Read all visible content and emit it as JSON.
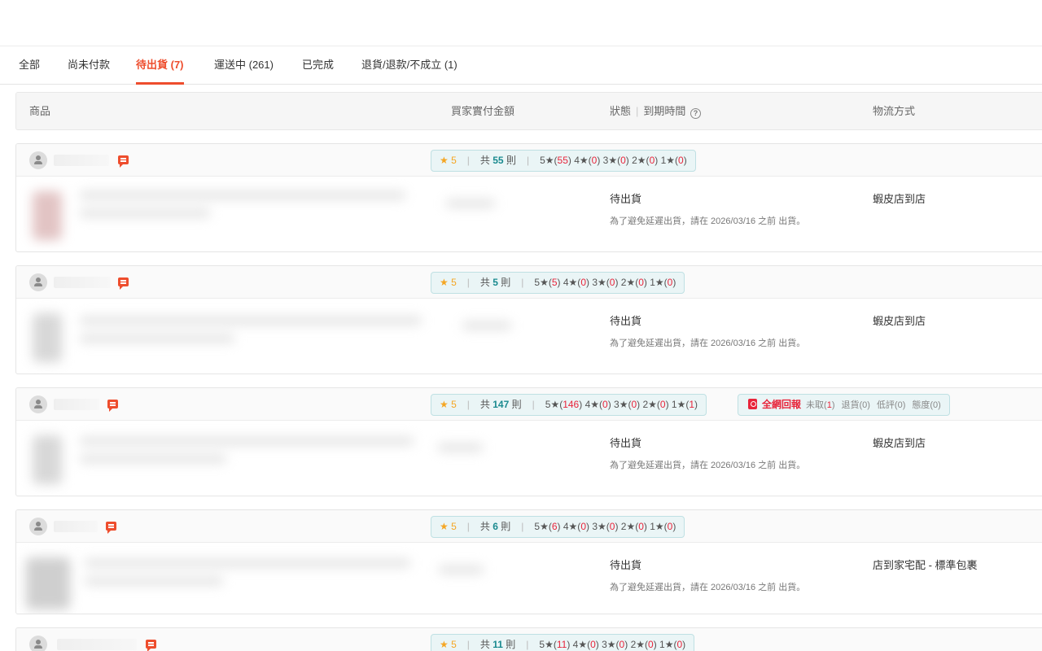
{
  "tabs": [
    {
      "label": "全部"
    },
    {
      "label": "尚未付款"
    },
    {
      "label": "待出貨 (7)"
    },
    {
      "label": "運送中 (261)"
    },
    {
      "label": "已完成"
    },
    {
      "label": "退貨/退款/不成立 (1)"
    }
  ],
  "active_tab": 2,
  "table_header": {
    "product": "商品",
    "amount": "買家實付金額",
    "status": "狀態",
    "separator": "|",
    "deadline": "到期時間",
    "help_glyph": "?",
    "shipping": "物流方式"
  },
  "colors": {
    "accent": "#ee4d2d",
    "teal": "#1a8a8f",
    "alert": "#e8253b"
  },
  "orders": [
    {
      "rating": {
        "star": "★ 5",
        "total_prefix": "共",
        "total": "55",
        "total_suffix": "則",
        "b5": "5★(",
        "c5": "55",
        "b4": ") 4★(",
        "c4": "0",
        "b3": ") 3★(",
        "c3": "0",
        "b2": ") 2★(",
        "c2": "0",
        "b1": ") 1★(",
        "c1": "0",
        "end": ")"
      },
      "status": "待出貨",
      "status_note": "為了避免延遲出貨，請在 2026/03/16 之前 出貨。",
      "shipping": "蝦皮店到店"
    },
    {
      "rating": {
        "star": "★ 5",
        "total_prefix": "共",
        "total": "5",
        "total_suffix": "則",
        "b5": "5★(",
        "c5": "5",
        "b4": ") 4★(",
        "c4": "0",
        "b3": ") 3★(",
        "c3": "0",
        "b2": ") 2★(",
        "c2": "0",
        "b1": ") 1★(",
        "c1": "0",
        "end": ")"
      },
      "status": "待出貨",
      "status_note": "為了避免延遲出貨，請在 2026/03/16 之前 出貨。",
      "shipping": "蝦皮店到店"
    },
    {
      "rating": {
        "star": "★ 5",
        "total_prefix": "共",
        "total": "147",
        "total_suffix": "則",
        "b5": "5★(",
        "c5": "146",
        "b4": ") 4★(",
        "c4": "0",
        "b3": ") 3★(",
        "c3": "0",
        "b2": ") 2★(",
        "c2": "0",
        "b1": ") 1★(",
        "c1": "1",
        "end": ")"
      },
      "net_report": {
        "title": "全網回報",
        "unpicked_label": "未取(",
        "unpicked": "1",
        "unpicked_end": ")",
        "returns": "退貨(0)",
        "low_rating": "低評(0)",
        "attitude": "態度(0)"
      },
      "status": "待出貨",
      "status_note": "為了避免延遲出貨，請在 2026/03/16 之前 出貨。",
      "shipping": "蝦皮店到店"
    },
    {
      "rating": {
        "star": "★ 5",
        "total_prefix": "共",
        "total": "6",
        "total_suffix": "則",
        "b5": "5★(",
        "c5": "6",
        "b4": ") 4★(",
        "c4": "0",
        "b3": ") 3★(",
        "c3": "0",
        "b2": ") 2★(",
        "c2": "0",
        "b1": ") 1★(",
        "c1": "0",
        "end": ")"
      },
      "status": "待出貨",
      "status_note": "為了避免延遲出貨，請在 2026/03/16 之前 出貨。",
      "shipping": "店到家宅配 - 標準包裹"
    },
    {
      "rating": {
        "star": "★ 5",
        "total_prefix": "共",
        "total": "11",
        "total_suffix": "則",
        "b5": "5★(",
        "c5": "11",
        "b4": ") 4★(",
        "c4": "0",
        "b3": ") 3★(",
        "c3": "0",
        "b2": ") 2★(",
        "c2": "0",
        "b1": ") 1★(",
        "c1": "0",
        "end": ")"
      }
    }
  ]
}
